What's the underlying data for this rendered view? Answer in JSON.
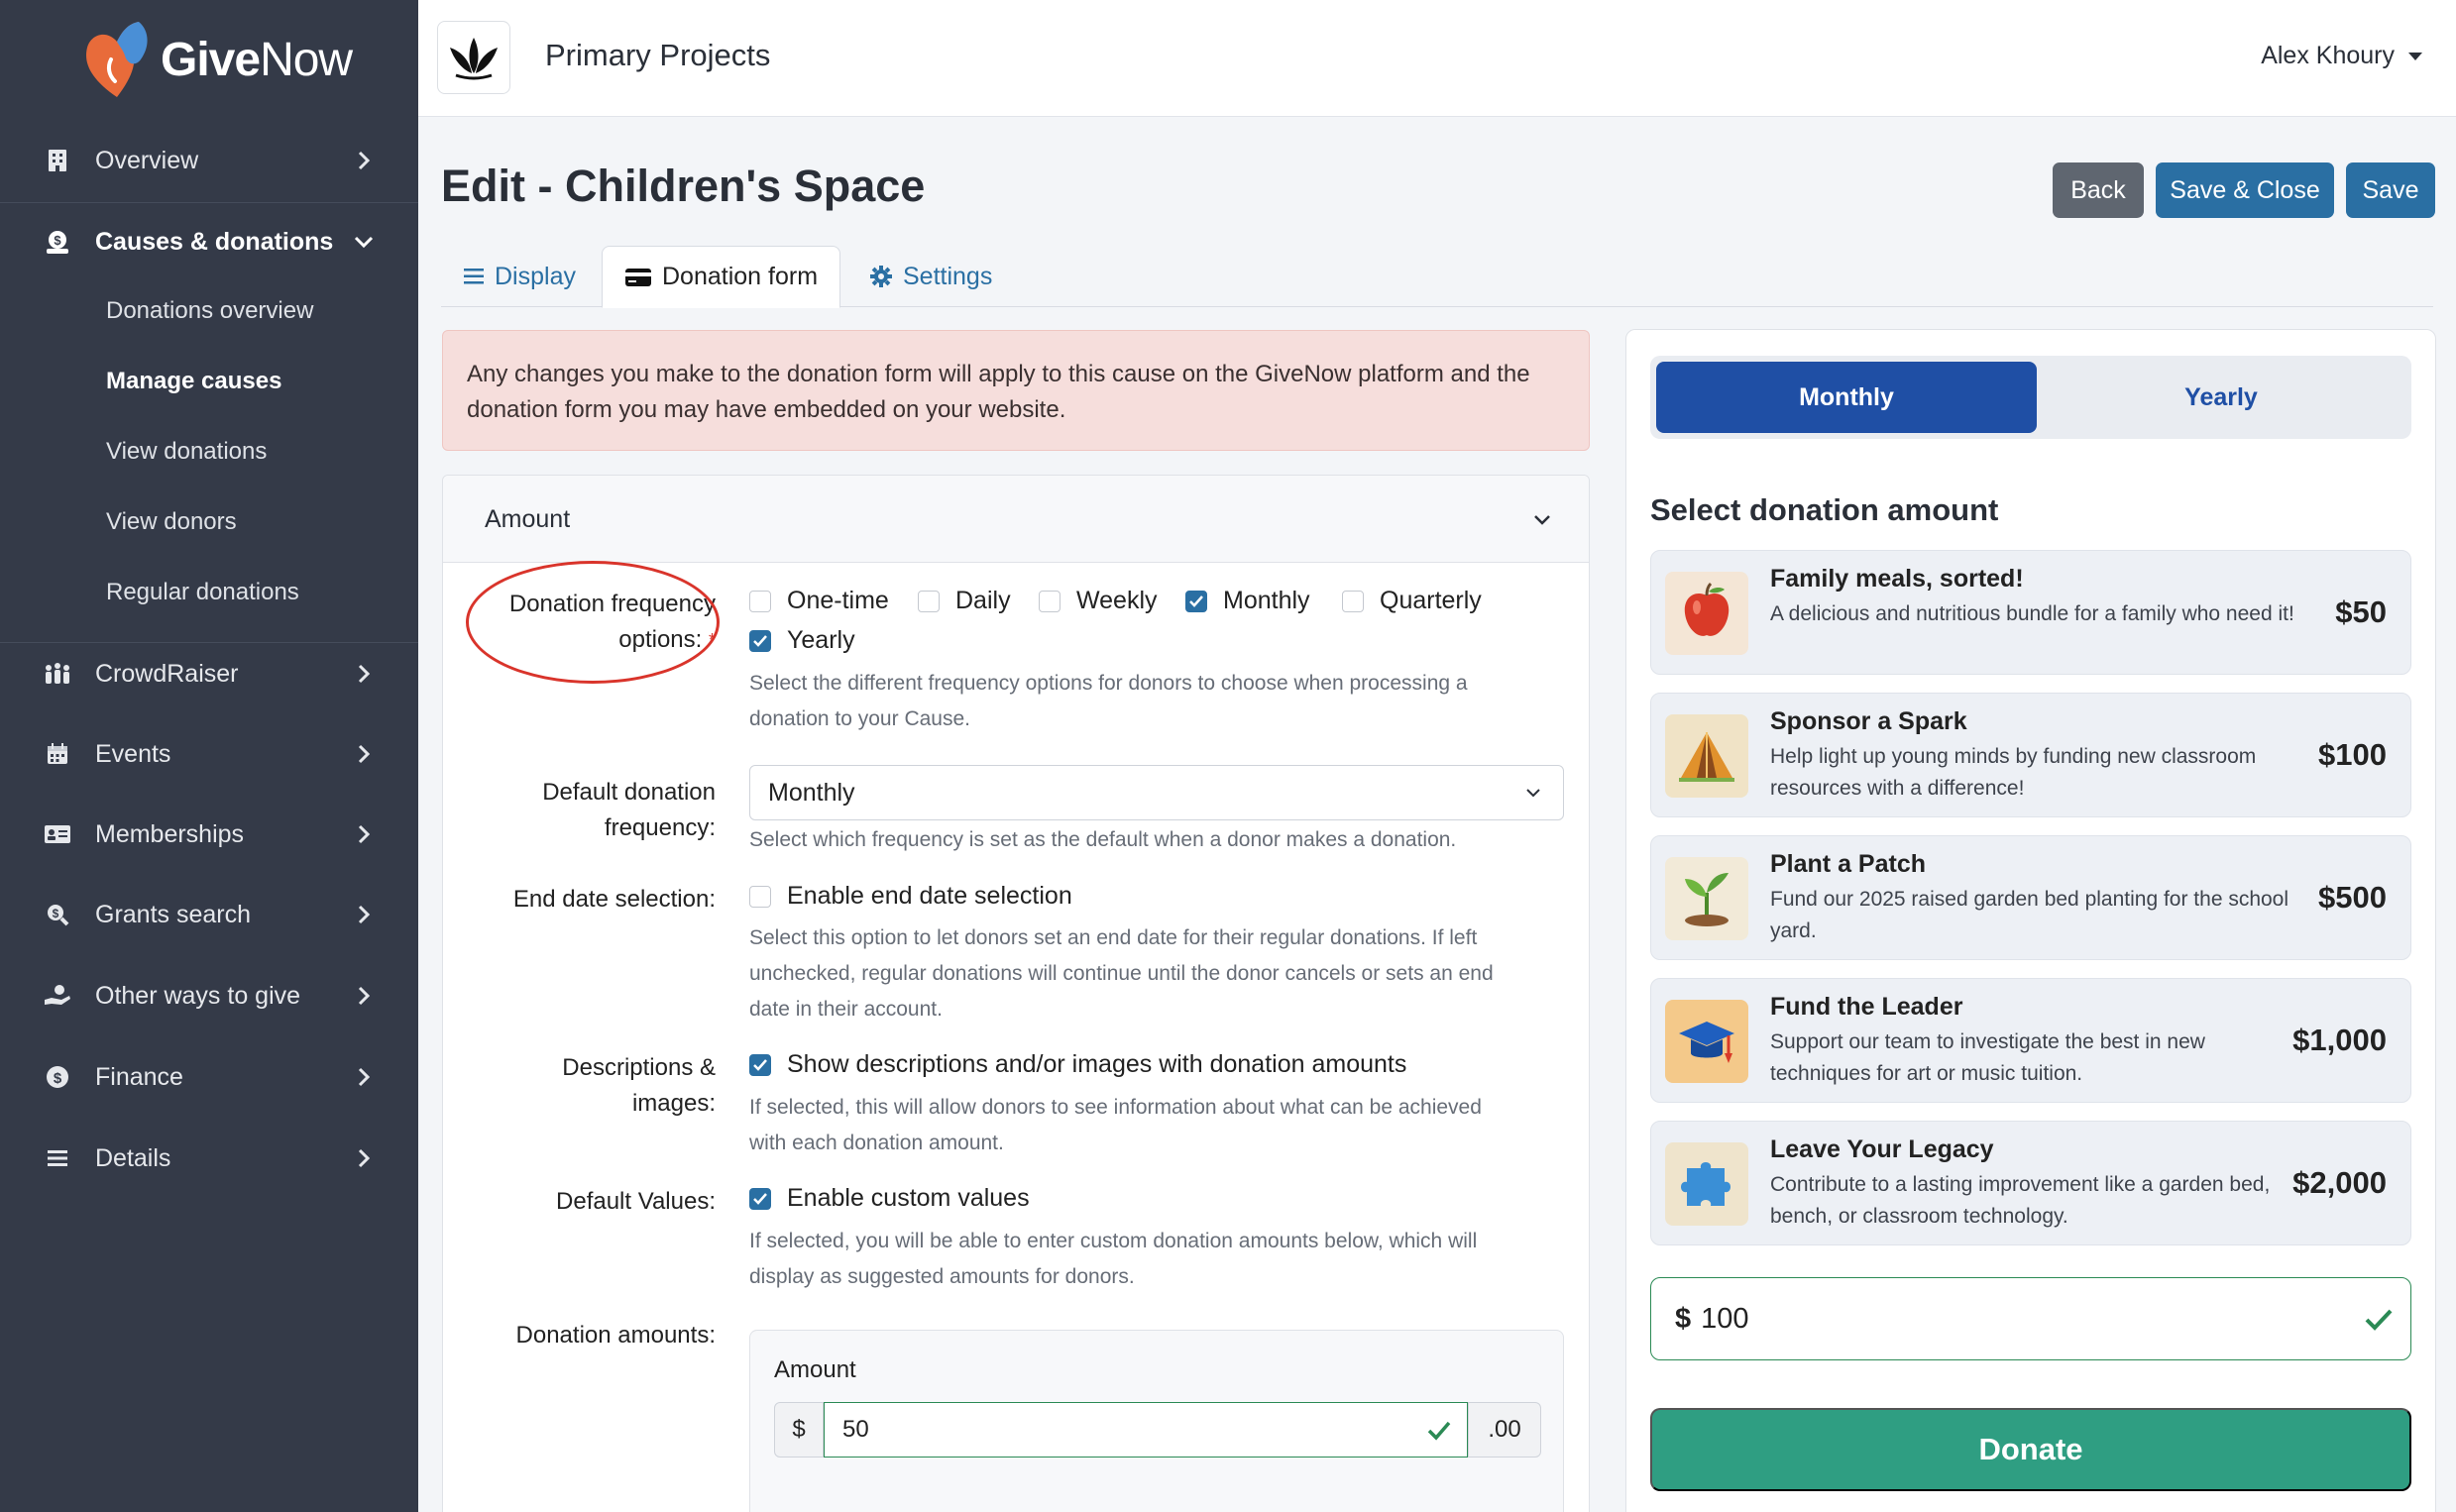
{
  "brand": {
    "name_bold": "Give",
    "name_light": "Now",
    "logo_colors": [
      "#e86b3a",
      "#4a8fd6"
    ]
  },
  "sidebar": {
    "items": [
      {
        "label": "Overview",
        "icon": "building-icon"
      },
      {
        "label": "Causes & donations",
        "icon": "donation-icon"
      },
      {
        "label": "CrowdRaiser",
        "icon": "crowd-icon"
      },
      {
        "label": "Events",
        "icon": "calendar-icon"
      },
      {
        "label": "Memberships",
        "icon": "id-card-icon"
      },
      {
        "label": "Grants search",
        "icon": "grant-search-icon"
      },
      {
        "label": "Other ways to give",
        "icon": "hand-give-icon"
      },
      {
        "label": "Finance",
        "icon": "dollar-icon"
      },
      {
        "label": "Details",
        "icon": "list-icon"
      }
    ],
    "subitems": [
      "Donations overview",
      "Manage causes",
      "View donations",
      "View donors",
      "Regular donations"
    ],
    "active_item": "Causes & donations",
    "active_subitem": "Manage causes"
  },
  "topbar": {
    "project": "Primary Projects",
    "user": "Alex Khoury"
  },
  "page": {
    "title": "Edit - Children's Space",
    "buttons": {
      "back": "Back",
      "save_close": "Save & Close",
      "save": "Save"
    },
    "tabs": [
      {
        "label": "Display",
        "icon": "list-icon"
      },
      {
        "label": "Donation form",
        "icon": "credit-card-icon"
      },
      {
        "label": "Settings",
        "icon": "gear-icon"
      }
    ],
    "active_tab": "Donation form",
    "alert": "Any changes you make to the donation form will apply to this cause on the GiveNow platform and the donation form you may have embedded on your website."
  },
  "form": {
    "section_title": "Amount",
    "frequency": {
      "label_line1": "Donation frequency",
      "label_line2": "options:",
      "required_mark": "*",
      "options": [
        {
          "label": "One-time",
          "checked": false
        },
        {
          "label": "Daily",
          "checked": false
        },
        {
          "label": "Weekly",
          "checked": false
        },
        {
          "label": "Monthly",
          "checked": true
        },
        {
          "label": "Quarterly",
          "checked": false
        },
        {
          "label": "Yearly",
          "checked": true
        }
      ],
      "help_line1": "Select the different frequency options for donors to choose when processing a",
      "help_line2": "donation to your Cause."
    },
    "default_frequency": {
      "label_line1": "Default donation",
      "label_line2": "frequency:",
      "value": "Monthly",
      "help": "Select which frequency is set as the default when a donor makes a donation."
    },
    "end_date": {
      "label": "End date selection:",
      "checkbox": "Enable end date selection",
      "checked": false,
      "help_line1": "Select this option to let donors set an end date for their regular donations. If left",
      "help_line2": "unchecked, regular donations will continue until the donor cancels or sets an end",
      "help_line3": "date in their account."
    },
    "descriptions": {
      "label_line1": "Descriptions &",
      "label_line2": "images:",
      "checkbox": "Show descriptions and/or images with donation amounts",
      "checked": true,
      "help_line1": "If selected, this will allow donors to see information about what can be achieved",
      "help_line2": "with each donation amount."
    },
    "default_values": {
      "label": "Default Values:",
      "checkbox": "Enable custom values",
      "checked": true,
      "help_line1": "If selected, you will be able to enter custom donation amounts below, which will",
      "help_line2": "display as suggested amounts for donors."
    },
    "amounts": {
      "label": "Donation amounts:",
      "amount_label": "Amount",
      "prefix": "$",
      "value": "50",
      "suffix": ".00"
    }
  },
  "preview": {
    "toggle": {
      "monthly": "Monthly",
      "yearly": "Yearly",
      "selected": "Monthly"
    },
    "select_title": "Select donation amount",
    "options": [
      {
        "title": "Family meals, sorted!",
        "desc": "A delicious and nutritious bundle for a family who need it!",
        "price": "$50",
        "icon": "apple-icon"
      },
      {
        "title": "Sponsor a Spark",
        "desc": "Help light up young minds by funding new classroom resources with a difference!",
        "price": "$100",
        "icon": "tent-icon"
      },
      {
        "title": "Plant a Patch",
        "desc": "Fund our 2025 raised garden bed planting for the school yard.",
        "price": "$500",
        "icon": "sprout-icon"
      },
      {
        "title": "Fund the Leader",
        "desc": "Support our team to investigate the best in new techniques for art or music tuition.",
        "price": "$1,000",
        "icon": "graduation-cap-icon"
      },
      {
        "title": "Leave Your Legacy",
        "desc": "Contribute to a lasting improvement like a garden bed, bench, or classroom technology.",
        "price": "$2,000",
        "icon": "puzzle-icon"
      }
    ],
    "amount_currency": "$",
    "amount_value": "100",
    "donate": "Donate"
  },
  "colors": {
    "sidebar": "#343a48",
    "primary": "#2a6fa3",
    "toggle_active": "#1f4fa5",
    "donate": "#2f9e82",
    "valid": "#2b8a55",
    "alert_bg": "#f6dedc",
    "annotation": "#d9342b"
  }
}
